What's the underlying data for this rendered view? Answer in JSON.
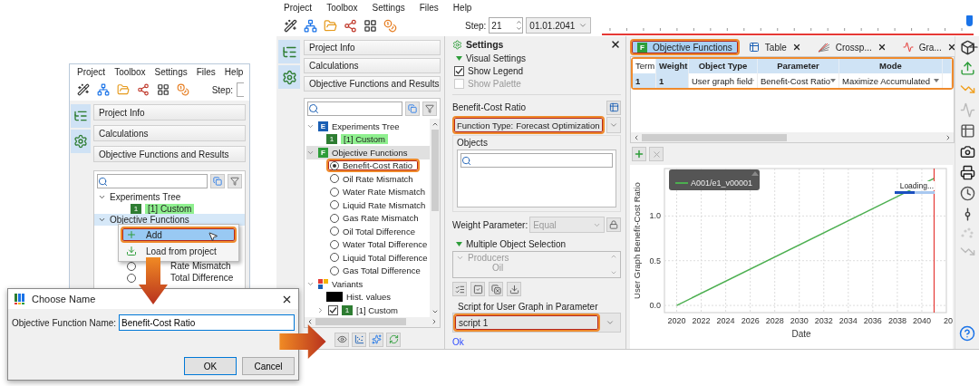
{
  "left_window": {
    "menu": [
      "Project",
      "Toolbox",
      "Settings",
      "Files",
      "Help"
    ],
    "step_label": "Step:",
    "panels": [
      {
        "label": "Project Info"
      },
      {
        "label": "Calculations"
      },
      {
        "label": "Objective Functions and Results"
      }
    ],
    "tree": [
      {
        "label": "Experiments Tree",
        "kind": "group",
        "expanded": true,
        "selected": false,
        "children": [
          {
            "label": "[1] Custom",
            "badge": "1",
            "kind": "experiment",
            "selected": false
          }
        ]
      },
      {
        "label": "Objective Functions",
        "kind": "group",
        "expanded": true,
        "selected": true
      }
    ],
    "context_menu": [
      {
        "label": "Add",
        "kind": "add",
        "selected": true,
        "highlighted": true
      },
      {
        "label": "Load from project",
        "kind": "load",
        "selected": false,
        "highlighted": false
      }
    ],
    "radio_items": [
      {
        "label": "Rate Mismatch",
        "selected": false
      },
      {
        "label": "Total Difference",
        "selected": false
      }
    ]
  },
  "dialog": {
    "title": "Choose Name",
    "field_label": "Objective Function Name:",
    "value": "Benefit-Cost Ratio",
    "buttons": [
      {
        "label": "OK",
        "default": true
      },
      {
        "label": "Cancel",
        "default": false
      }
    ]
  },
  "main_window": {
    "menu": [
      "Project",
      "Toolbox",
      "Settings",
      "Files",
      "Help"
    ],
    "step": {
      "label": "Step:",
      "value": "21"
    },
    "date": "01.01.2041",
    "timeline": {
      "level": 0.99
    },
    "panels": [
      {
        "label": "Project Info"
      },
      {
        "label": "Calculations"
      },
      {
        "label": "Objective Functions and Results"
      }
    ],
    "tree": [
      {
        "label": "Experiments Tree",
        "kind": "experiments",
        "icon_letter": "E",
        "expanded": true,
        "selected": false,
        "children": [
          {
            "label": "[1] Custom",
            "badge": "1",
            "kind": "experiment",
            "selected": false
          }
        ]
      },
      {
        "label": "Objective Functions",
        "kind": "functions",
        "icon_letter": "F",
        "expanded": true,
        "selected": true,
        "children": [
          {
            "label": "Benefit-Cost Ratio",
            "kind": "radio",
            "selected": true,
            "highlighted": true
          },
          {
            "label": "Oil Rate Mismatch",
            "kind": "radio",
            "selected": false,
            "highlighted": false
          },
          {
            "label": "Water Rate Mismatch",
            "kind": "radio",
            "selected": false,
            "highlighted": false
          },
          {
            "label": "Liquid Rate Mismatch",
            "kind": "radio",
            "selected": false,
            "highlighted": false
          },
          {
            "label": "Gas Rate Mismatch",
            "kind": "radio",
            "selected": false,
            "highlighted": false
          },
          {
            "label": "Oil Total Difference",
            "kind": "radio",
            "selected": false,
            "highlighted": false
          },
          {
            "label": "Water Total Difference",
            "kind": "radio",
            "selected": false,
            "highlighted": false
          },
          {
            "label": "Liquid Total Difference",
            "kind": "radio",
            "selected": false,
            "highlighted": false
          },
          {
            "label": "Gas Total Difference",
            "kind": "radio",
            "selected": false,
            "highlighted": false
          }
        ]
      },
      {
        "label": "Variants",
        "kind": "variants",
        "expanded": true,
        "selected": false,
        "children": [
          {
            "label": "Hist. values",
            "kind": "swatch",
            "selected": false
          },
          {
            "label": "[1] Custom",
            "kind": "variant",
            "badge": "1",
            "checked": true,
            "expanded": false,
            "selected": false
          }
        ]
      }
    ],
    "settings": {
      "title": "Settings",
      "visual_settings": {
        "label": "Visual Settings",
        "expanded": true
      },
      "options": [
        {
          "label": "Show Legend",
          "checked": true,
          "disabled": false
        },
        {
          "label": "Show Palette",
          "checked": false,
          "disabled": true
        }
      ],
      "function_name": "Benefit-Cost Ratio",
      "function_type": {
        "label": "Function Type:",
        "value": "Forecast Optimization",
        "highlighted": true
      },
      "objects": {
        "label": "Objects"
      },
      "weight_parameter": {
        "label": "Weight Parameter:",
        "value": "Equal",
        "disabled": true
      },
      "multiple_selection": {
        "label": "Multiple Object Selection",
        "expanded": true,
        "tree": [
          {
            "label": "Producers",
            "expanded": true,
            "children": [
              {
                "label": "Oil"
              }
            ]
          }
        ]
      },
      "script": {
        "label": "Script for User Graph in Parameter",
        "value": "script 1",
        "highlighted": true
      },
      "status": "Ok"
    },
    "tabs": [
      {
        "label": "Objective Functions",
        "kind": "functions",
        "icon_letter": "F",
        "selected": true,
        "closable": false,
        "highlighted": true
      },
      {
        "label": "Table",
        "kind": "table",
        "selected": false,
        "closable": true,
        "highlighted": false
      },
      {
        "label": "Crossp...",
        "kind": "crossplot",
        "selected": false,
        "closable": true,
        "highlighted": false
      },
      {
        "label": "Gra...",
        "kind": "graph",
        "selected": false,
        "closable": true,
        "highlighted": false
      }
    ],
    "table": {
      "highlighted": true,
      "columns": [
        "Term",
        "Weight",
        "Object Type",
        "Parameter",
        "Mode"
      ],
      "rows": [
        {
          "selected": true,
          "cells": [
            "1",
            "1",
            "User graph field",
            "Benefit-Cost Ratio",
            "Maximize Accumulated"
          ]
        }
      ]
    },
    "chart": {
      "loading": {
        "label": "Loading...",
        "level": 0.5
      },
      "cut_tick_label": "20",
      "chart_data": {
        "type": "line",
        "xlabel": "Date",
        "ylabel": "User Graph Benefit-Cost Ratio",
        "x": [
          2020,
          2041
        ],
        "series": [
          {
            "name": "A001/e1_v00001",
            "color": "#4caf50",
            "values": [
              0,
              1.42
            ]
          }
        ],
        "xlim": [
          2019,
          2042
        ],
        "ylim": [
          -0.08,
          1.53
        ],
        "xticks": [
          2020,
          2022,
          2024,
          2026,
          2028,
          2030,
          2032,
          2034,
          2036,
          2038,
          2040
        ],
        "grid": true,
        "yticks": [
          {
            "value": 0,
            "label": "0.0"
          },
          {
            "value": 0.5,
            "label": "0.5"
          },
          {
            "value": 1,
            "label": "1.0"
          }
        ],
        "ref_lines": [
          {
            "axis": "x",
            "value": 2041
          }
        ]
      }
    }
  }
}
